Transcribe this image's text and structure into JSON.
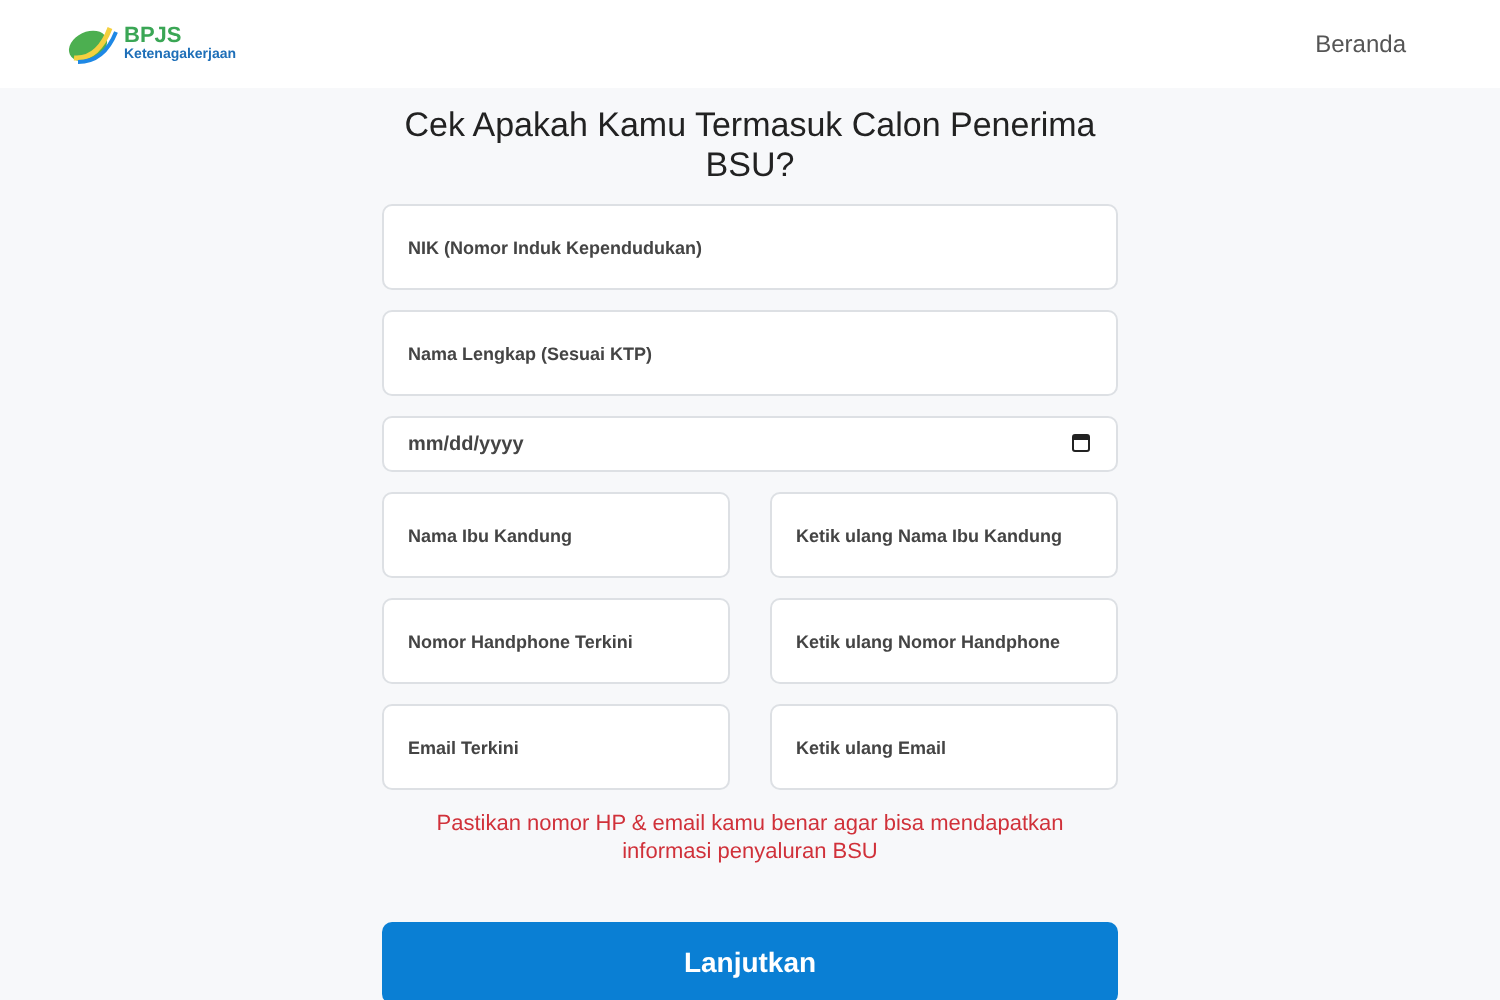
{
  "header": {
    "logo": {
      "title": "BPJS",
      "subtitle": "Ketenagakerjaan"
    },
    "nav": [
      "Beranda"
    ]
  },
  "form": {
    "title": "Cek Apakah Kamu Termasuk Calon Penerima BSU?",
    "rows": [
      [
        {
          "kind": "text",
          "placeholder": "NIK (Nomor Induk Kependudukan)"
        }
      ],
      [
        {
          "kind": "text",
          "placeholder": "Nama Lengkap (Sesuai KTP)"
        }
      ],
      [
        {
          "kind": "date",
          "placeholder": "mm/dd/yyyy"
        }
      ],
      [
        {
          "kind": "text",
          "placeholder": "Nama Ibu Kandung"
        },
        {
          "kind": "text",
          "placeholder": "Ketik ulang Nama Ibu Kandung"
        }
      ],
      [
        {
          "kind": "text",
          "placeholder": "Nomor Handphone Terkini"
        },
        {
          "kind": "text",
          "placeholder": "Ketik ulang Nomor Handphone"
        }
      ],
      [
        {
          "kind": "text",
          "placeholder": "Email Terkini"
        },
        {
          "kind": "text",
          "placeholder": "Ketik ulang Email"
        }
      ]
    ],
    "note": "Pastikan nomor HP & email kamu benar agar bisa mendapatkan informasi penyaluran BSU",
    "submit": "Lanjutkan"
  }
}
